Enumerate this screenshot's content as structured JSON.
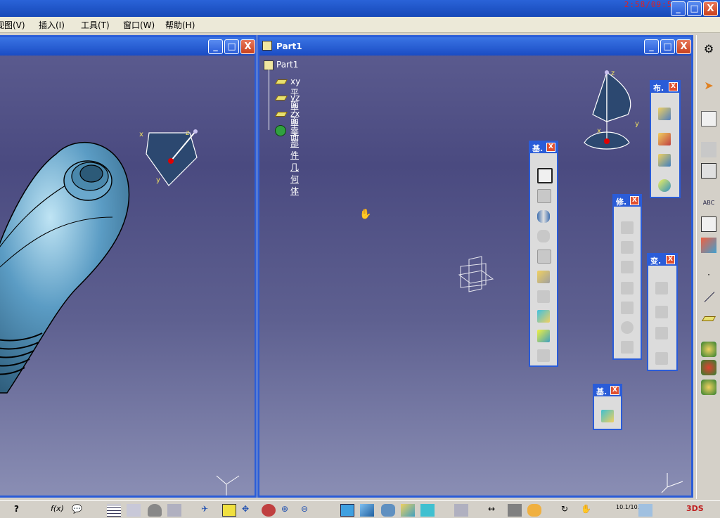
{
  "app": {
    "clock": "2:58/09:58",
    "window_buttons": {
      "minimize": "_",
      "maximize": "□",
      "close": "X"
    }
  },
  "menubar": {
    "items": [
      {
        "label": "视图(V)"
      },
      {
        "label": "插入(I)"
      },
      {
        "label": "工具(T)"
      },
      {
        "label": "窗口(W)"
      },
      {
        "label": "帮助(H)"
      }
    ]
  },
  "left_window": {
    "buttons": {
      "minimize": "_",
      "maximize": "□",
      "close": "X"
    }
  },
  "part_window": {
    "title": "Part1",
    "buttons": {
      "minimize": "_",
      "maximize": "□",
      "close": "X"
    },
    "tree": {
      "root": "Part1",
      "items": [
        {
          "label": "xy 平面",
          "icon": "plane-icon"
        },
        {
          "label": "yz 平面",
          "icon": "plane-icon"
        },
        {
          "label": "zx 平面",
          "icon": "plane-icon"
        },
        {
          "label": "零部件几何体",
          "icon": "body-icon"
        }
      ]
    },
    "compass_axes": {
      "x": "x",
      "y": "y",
      "z": "z"
    }
  },
  "floating_toolbars": [
    {
      "id": "layout",
      "title": "布.",
      "close": "X"
    },
    {
      "id": "base1",
      "title": "基.",
      "close": "X"
    },
    {
      "id": "modify",
      "title": "修.",
      "close": "X"
    },
    {
      "id": "transform",
      "title": "变.",
      "close": "X"
    },
    {
      "id": "base2",
      "title": "基.",
      "close": "X"
    }
  ],
  "colors": {
    "title_blue": "#1a4cc4",
    "viewport_top": "#4a4a80",
    "viewport_bottom": "#8a8eb4",
    "bottle": "#5b9cc4",
    "toolbar_bg": "#d4d0c8"
  },
  "bottom_toolbar": {
    "labels": {
      "fx": "f(x)",
      "scale": "10.1/10.0"
    }
  },
  "right_toolbar": {
    "labels": {
      "abc": "ABC"
    }
  }
}
